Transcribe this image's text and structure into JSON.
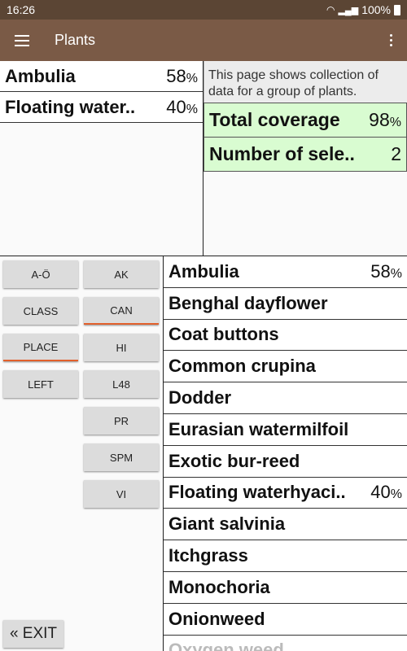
{
  "status_bar": {
    "time": "16:26",
    "battery": "100%"
  },
  "app_bar": {
    "title": "Plants"
  },
  "selected": [
    {
      "name": "Ambulia",
      "value": "58",
      "unit": "%"
    },
    {
      "name": "Floating water..",
      "value": "40",
      "unit": "%"
    }
  ],
  "info": {
    "description": "This page shows collection of data for a group of plants.",
    "total_label": "Total coverage",
    "total_value": "98",
    "total_unit": "%",
    "count_label": "Number of sele..",
    "count_value": "2"
  },
  "buttons": {
    "col1": [
      "A-Ö",
      "CLASS",
      "PLACE",
      "LEFT"
    ],
    "col2": [
      "AK",
      "CAN",
      "HI",
      "L48",
      "PR",
      "SPM",
      "VI"
    ],
    "active": [
      "CAN",
      "PLACE"
    ],
    "exit": "« EXIT"
  },
  "plants": [
    {
      "name": "Ambulia",
      "value": "58",
      "unit": "%"
    },
    {
      "name": "Benghal dayflower"
    },
    {
      "name": "Coat buttons"
    },
    {
      "name": "Common crupina"
    },
    {
      "name": "Dodder"
    },
    {
      "name": "Eurasian watermilfoil"
    },
    {
      "name": "Exotic bur-reed"
    },
    {
      "name": "Floating waterhyaci..",
      "value": "40",
      "unit": "%"
    },
    {
      "name": "Giant salvinia"
    },
    {
      "name": "Itchgrass"
    },
    {
      "name": "Monochoria"
    },
    {
      "name": "Onionweed"
    },
    {
      "name": "Oxygen weed"
    }
  ],
  "colors": {
    "status_bar": "#5b4534",
    "app_bar": "#7a5a46",
    "stat_bg": "#d9fcd1",
    "active_underline": "#e2602c"
  }
}
